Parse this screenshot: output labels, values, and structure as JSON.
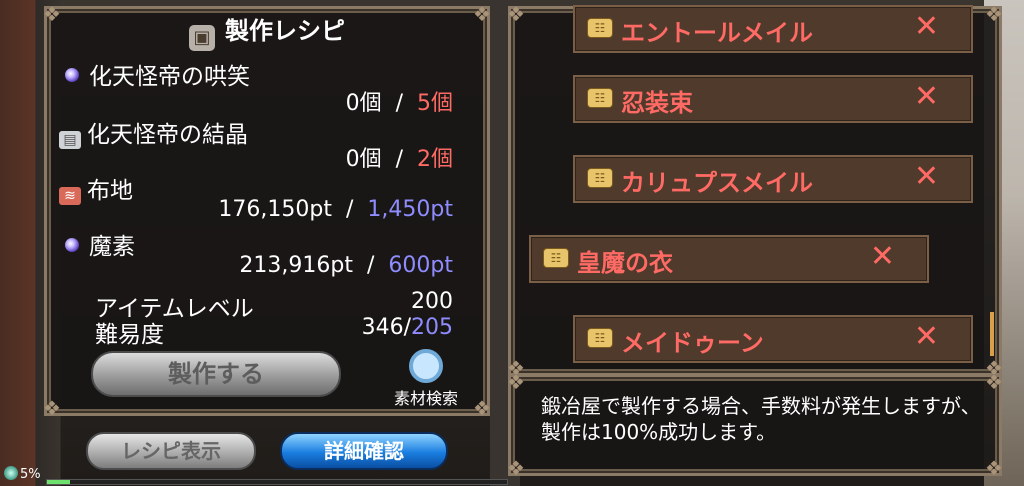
{
  "title": "製作レシピ",
  "materials": [
    {
      "name": "化天怪帝の哄笑",
      "icon": "purple-orb-icon",
      "owned": "0個",
      "separator": "/",
      "required": "5個"
    },
    {
      "name": "化天怪帝の結晶",
      "icon": "crystal-box-icon",
      "owned": "0個",
      "separator": "/",
      "required": "2個"
    },
    {
      "name": "布地",
      "icon": "cloth-icon",
      "owned": "176,150pt",
      "separator": "/",
      "required": "1,450pt"
    },
    {
      "name": "魔素",
      "icon": "purple-orb-icon",
      "owned": "213,916pt",
      "separator": "/",
      "required": "600pt"
    }
  ],
  "item_level": {
    "label": "アイテムレベル",
    "value": "200"
  },
  "difficulty": {
    "label": "難易度",
    "value": "346/",
    "target": "205"
  },
  "buttons": {
    "craft": "製作する",
    "search": "素材検索",
    "recipe_display": "レシピ表示",
    "detail_confirm": "詳細確認"
  },
  "recipe_list": [
    {
      "label": "エントールメイル",
      "remove": "✕"
    },
    {
      "label": "忍装束",
      "remove": "✕"
    },
    {
      "label": "カリュプスメイル",
      "remove": "✕"
    },
    {
      "label": "皇魔の衣",
      "remove": "✕"
    },
    {
      "label": "メイドゥーン",
      "remove": "✕"
    }
  ],
  "description": "鍛冶屋で製作する場合、手数料が発生しますが、製作は100%成功します。",
  "status": {
    "percent": "5%",
    "fill": 0.05
  },
  "colors": {
    "red": "#ff6a64",
    "blue": "#8f8cff"
  }
}
